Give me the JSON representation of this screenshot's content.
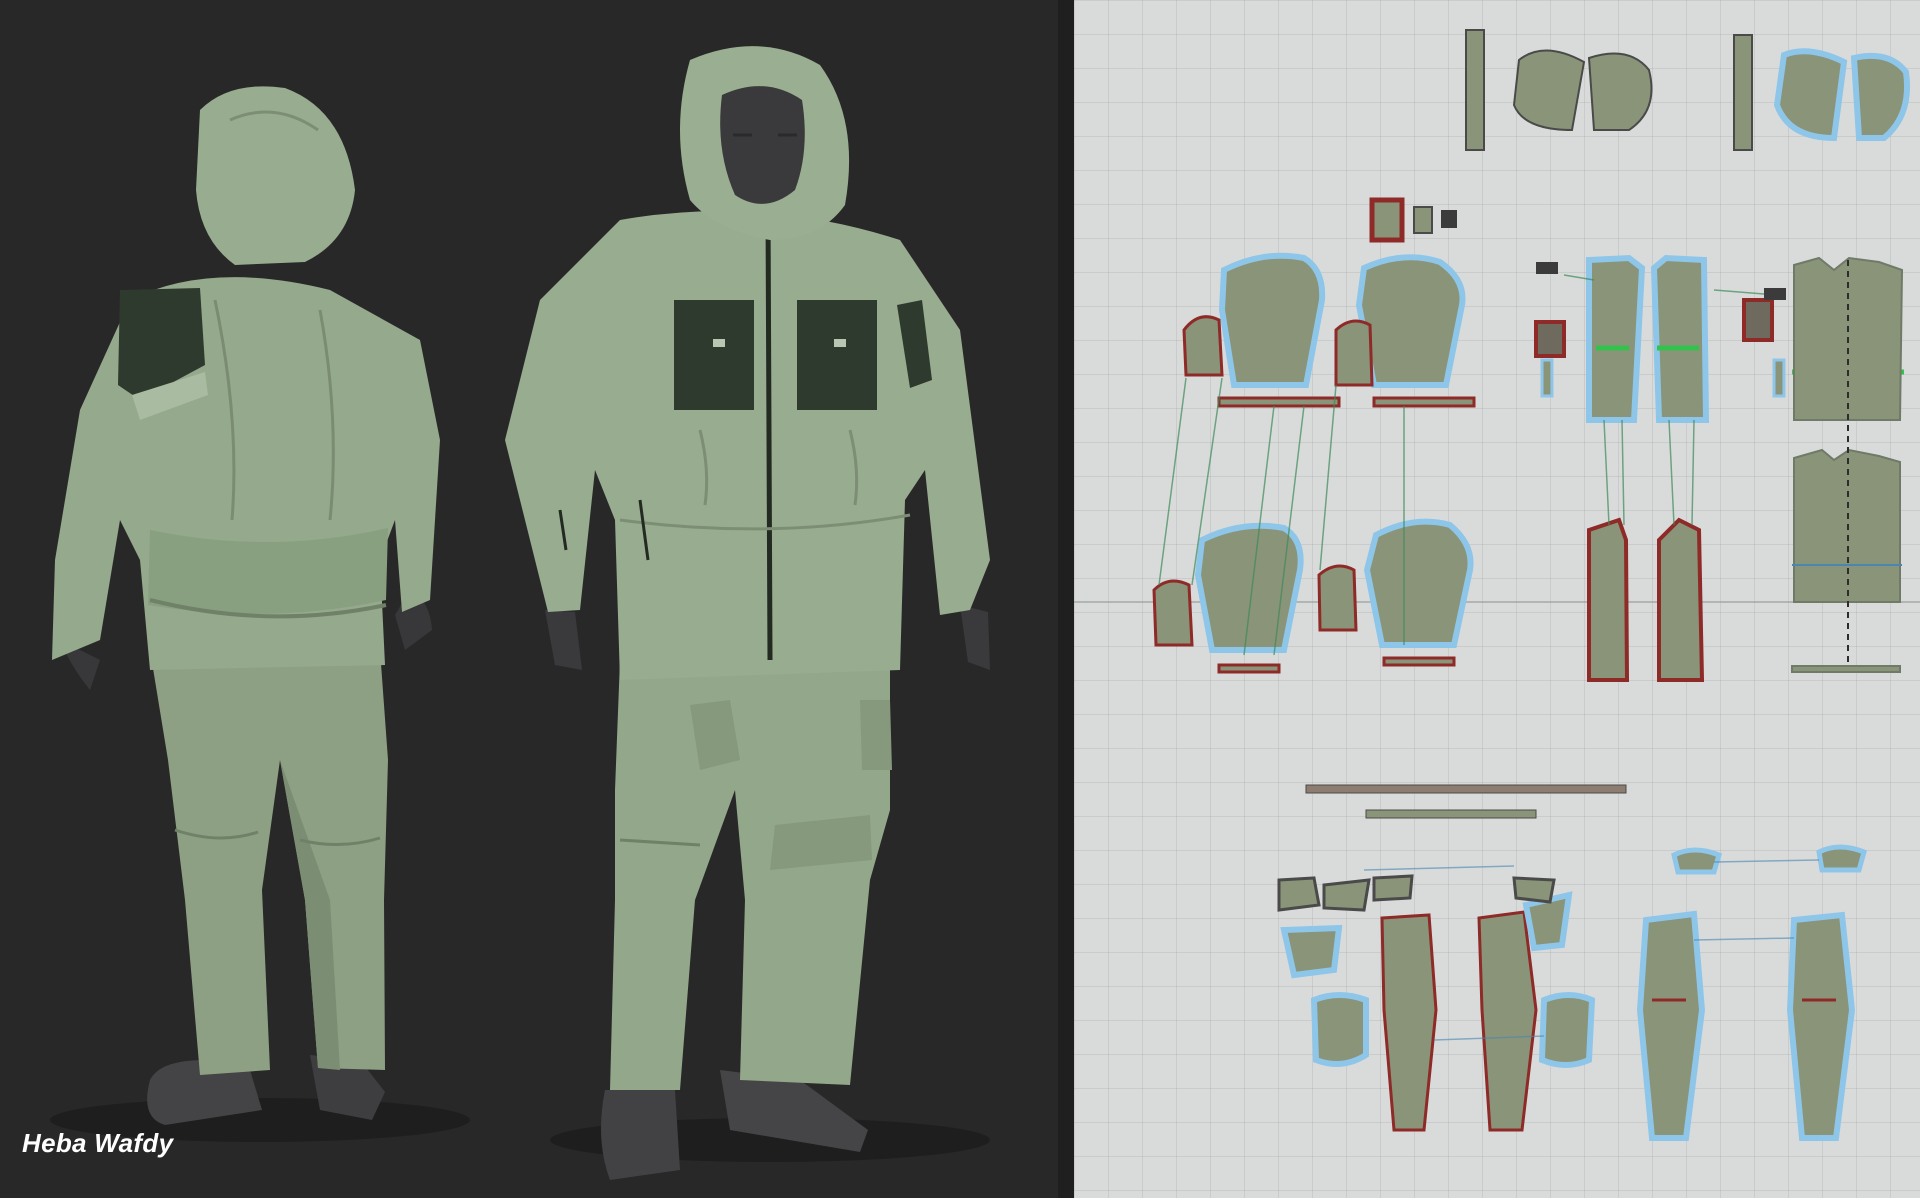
{
  "credit": {
    "author": "Heba Wafdy"
  },
  "colors": {
    "fabric": "#93a78a",
    "fabric_shadow": "#6f8268",
    "patch": "#2f3a2e",
    "skin": "#3b3b3d",
    "boots": "#434345",
    "viewport_bg": "#282829",
    "grid_bg": "#d9dbdb",
    "piece_fill": "#8a9478",
    "piece_edge": "#8e2a27",
    "selection_glow": "#8ec6ea",
    "sewing_line": "#3f8a5a",
    "highlight_green": "#33c24b"
  },
  "icons": [
    "avatar-figure-back",
    "avatar-figure-front",
    "pattern-piece"
  ]
}
